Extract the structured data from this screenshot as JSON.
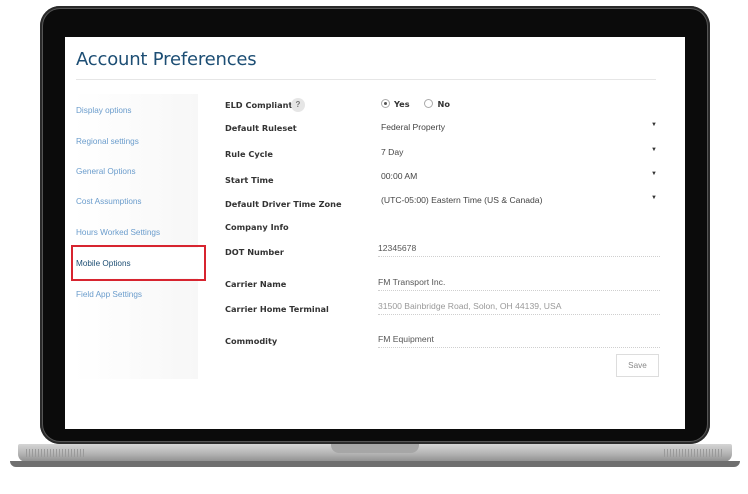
{
  "page_title": "Account Preferences",
  "sidebar": {
    "items": [
      {
        "label": "Display options"
      },
      {
        "label": "Regional settings"
      },
      {
        "label": "General Options"
      },
      {
        "label": "Cost Assumptions"
      },
      {
        "label": "Hours Worked Settings"
      },
      {
        "label": "Mobile Options"
      },
      {
        "label": "Field App Settings"
      }
    ],
    "active_item": "Mobile Options"
  },
  "form": {
    "eld_compliant": {
      "label": "ELD Compliant",
      "help": "?",
      "yes_label": "Yes",
      "no_label": "No",
      "selected": "Yes"
    },
    "default_ruleset": {
      "label": "Default Ruleset",
      "value": "Federal Property"
    },
    "rule_cycle": {
      "label": "Rule Cycle",
      "value": "7 Day"
    },
    "start_time": {
      "label": "Start Time",
      "value": "00:00 AM"
    },
    "time_zone": {
      "label": "Default Driver Time Zone",
      "value": "(UTC-05:00) Eastern Time (US & Canada)"
    },
    "company_info": {
      "label": "Company Info"
    },
    "dot_number": {
      "label": "DOT Number",
      "value": "12345678"
    },
    "carrier_name": {
      "label": "Carrier Name",
      "value": "FM Transport Inc."
    },
    "carrier_home_terminal": {
      "label": "Carrier Home Terminal",
      "value": "31500 Bainbridge Road, Solon, OH 44139, USA"
    },
    "commodity": {
      "label": "Commodity",
      "value": "FM Equipment"
    },
    "save_label": "Save"
  },
  "icons": {
    "dropdown": "chevron-down-icon",
    "help": "help-icon"
  },
  "colors": {
    "title": "#1d4e74",
    "sidebar_link": "#6a9ccc",
    "highlight": "#d7242f",
    "laptop_bezel": "#0b0b0b"
  }
}
